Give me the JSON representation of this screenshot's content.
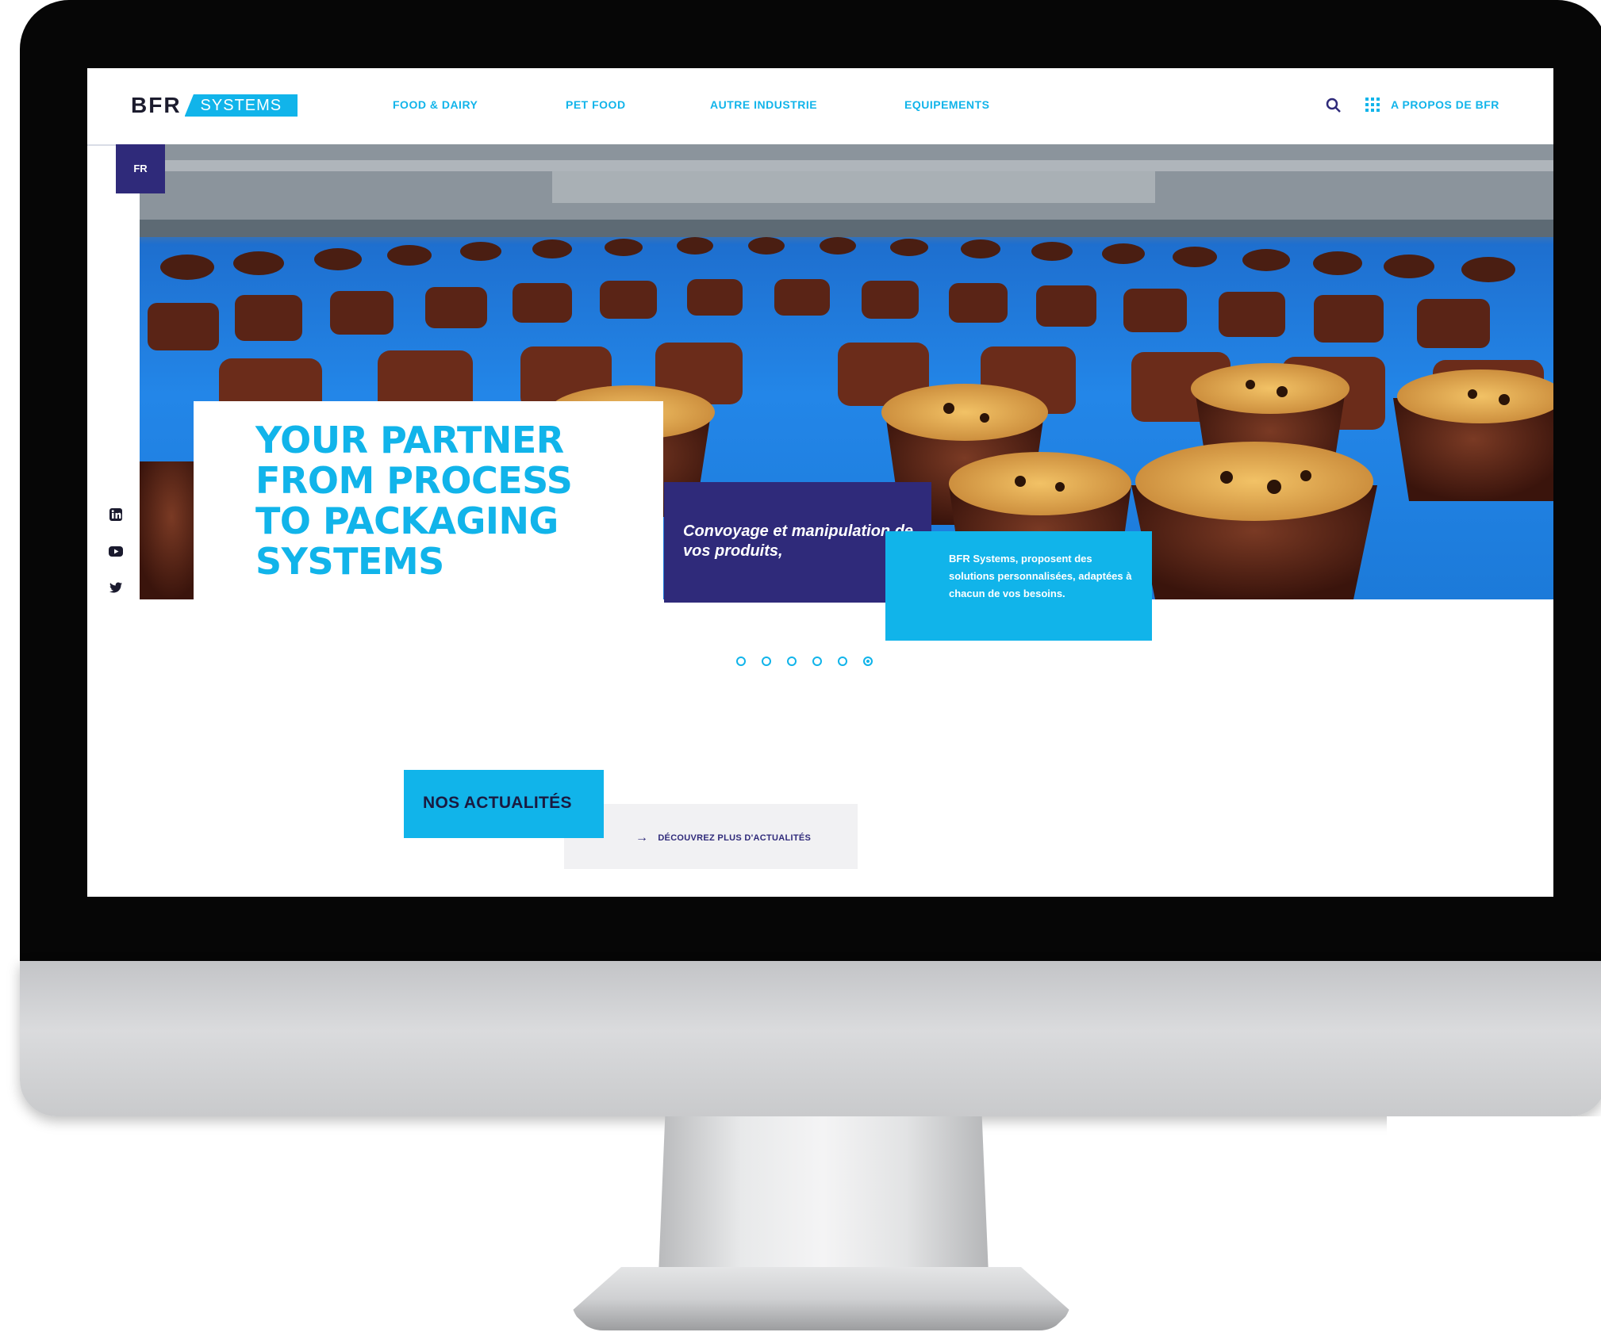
{
  "logo": {
    "brand": "BFR",
    "suffix": "SYSTEMS"
  },
  "nav": {
    "items": [
      "FOOD & DAIRY",
      "PET FOOD",
      "AUTRE INDUSTRIE",
      "EQUIPEMENTS"
    ],
    "about": "A PROPOS DE BFR"
  },
  "language": "FR",
  "hero": {
    "headline": "YOUR PARTNER FROM PROCESS TO PACKAGING SYSTEMS",
    "tagline": "Convoyage et manipulation de vos produits,",
    "description": "BFR Systems, proposent des solutions personnalisées, adaptées à chacun de vos besoins."
  },
  "carousel": {
    "count": 6,
    "active_index": 5
  },
  "news": {
    "title": "NOS ACTUALITÉS",
    "more_link": "DÉCOUVREZ PLUS D'ACTUALITÉS"
  },
  "colors": {
    "accent": "#11b4ea",
    "primary_dark": "#2f2a7a",
    "monitor_bezel": "#060606"
  },
  "icons": {
    "search": "search-icon",
    "menu": "grid-menu-icon",
    "social": [
      "linkedin-icon",
      "youtube-icon",
      "twitter-icon"
    ],
    "arrow": "arrow-right-icon"
  }
}
